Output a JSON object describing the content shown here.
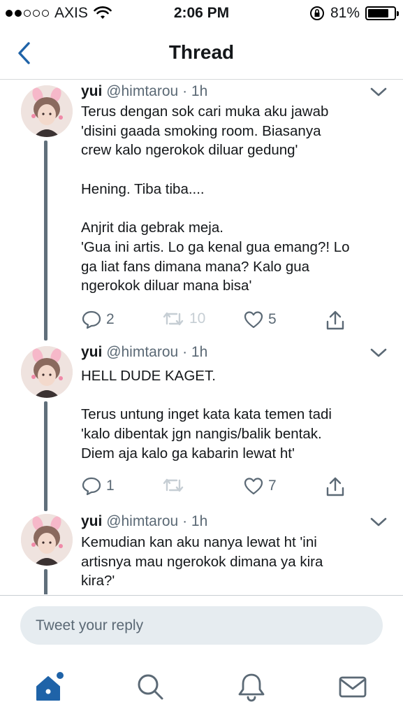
{
  "status_bar": {
    "carrier": "AXIS",
    "signal_bars_filled": 2,
    "signal_bars_total": 5,
    "time": "2:06 PM",
    "battery_percent": "81%"
  },
  "nav": {
    "title": "Thread",
    "back_icon": "chevron-left-icon"
  },
  "colors": {
    "accent": "#1f63a8",
    "thread_line": "#606f7b",
    "muted_text": "#5b6975",
    "reply_bg": "#e6ecf0",
    "notification_dot": "#1f63a8"
  },
  "tweets": [
    {
      "name": "yui",
      "handle": "@himtarou",
      "time": "· 1h",
      "lines": [
        "Terus dengan sok cari muka aku jawab",
        "'disini gaada smoking room. Biasanya",
        "crew kalo ngerokok diluar gedung'",
        "",
        "Hening. Tiba tiba....",
        "",
        "Anjrit dia gebrak meja.",
        "'Gua ini artis. Lo ga kenal gua emang?! Lo",
        "ga liat fans dimana mana? Kalo gua",
        "ngerokok diluar mana bisa'"
      ],
      "replies": "2",
      "retweets": "10",
      "likes": "5"
    },
    {
      "name": "yui",
      "handle": "@himtarou",
      "time": "· 1h",
      "lines": [
        "HELL DUDE KAGET.",
        "",
        "Terus untung inget kata kata temen tadi",
        "'kalo dibentak jgn nangis/balik bentak.",
        "Diem aja kalo ga kabarin lewat ht'"
      ],
      "replies": "1",
      "retweets": "",
      "likes": "7"
    },
    {
      "name": "yui",
      "handle": "@himtarou",
      "time": "· 1h",
      "lines": [
        "Kemudian kan aku nanya lewat ht 'ini",
        "artisnya mau ngerokok dimana ya kira",
        "kira?'"
      ]
    }
  ],
  "reply": {
    "placeholder": "Tweet your reply"
  },
  "tabs": [
    {
      "name": "home",
      "icon": "home-icon",
      "active": true,
      "has_dot": true
    },
    {
      "name": "search",
      "icon": "search-icon"
    },
    {
      "name": "notifications",
      "icon": "bell-icon"
    },
    {
      "name": "messages",
      "icon": "mail-icon"
    }
  ]
}
